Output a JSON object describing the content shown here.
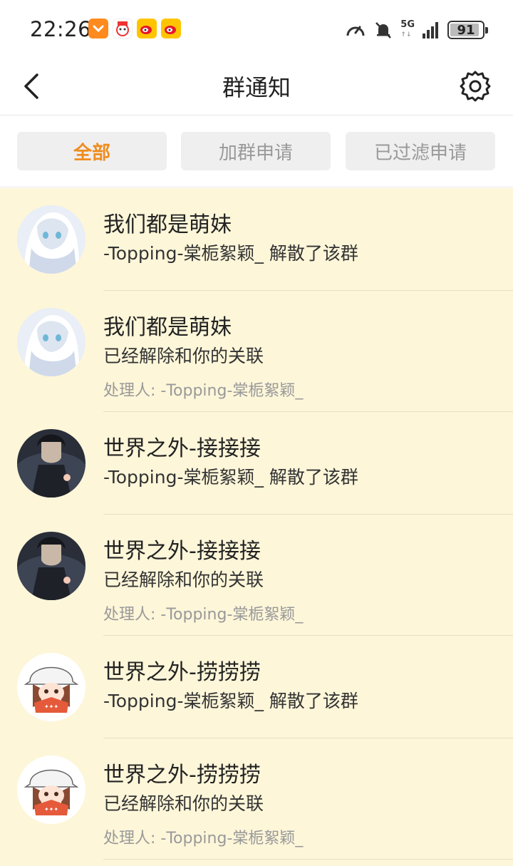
{
  "status_bar": {
    "time": "22:26",
    "network": "5G",
    "battery": "91",
    "battery_level": 0.91
  },
  "nav": {
    "title": "群通知"
  },
  "tabs": [
    {
      "label": "全部",
      "active": true
    },
    {
      "label": "加群申请",
      "active": false
    },
    {
      "label": "已过滤申请",
      "active": false
    }
  ],
  "items": [
    {
      "group": "我们都是萌妹",
      "message": "-Topping-棠栀絮颖_ 解散了该群",
      "handler": "",
      "avatar": "anime-girl-white-hair"
    },
    {
      "group": "我们都是萌妹",
      "message": "已经解除和你的关联",
      "handler": "处理人: -Topping-棠栀絮颖_",
      "avatar": "anime-girl-white-hair"
    },
    {
      "group": "世界之外-接接接",
      "message": "-Topping-棠栀絮颖_ 解散了该群",
      "handler": "",
      "avatar": "dark-haired-man"
    },
    {
      "group": "世界之外-接接接",
      "message": "已经解除和你的关联",
      "handler": "处理人: -Topping-棠栀絮颖_",
      "avatar": "dark-haired-man"
    },
    {
      "group": "世界之外-捞捞捞",
      "message": "-Topping-棠栀絮颖_ 解散了该群",
      "handler": "",
      "avatar": "chibi-girl-white-cap"
    },
    {
      "group": "世界之外-捞捞捞",
      "message": "已经解除和你的关联",
      "handler": "处理人: -Topping-棠栀絮颖_",
      "avatar": "chibi-girl-white-cap"
    }
  ],
  "colors": {
    "list_background": "#fdf6d9",
    "active_tab": "#f08c1e"
  }
}
